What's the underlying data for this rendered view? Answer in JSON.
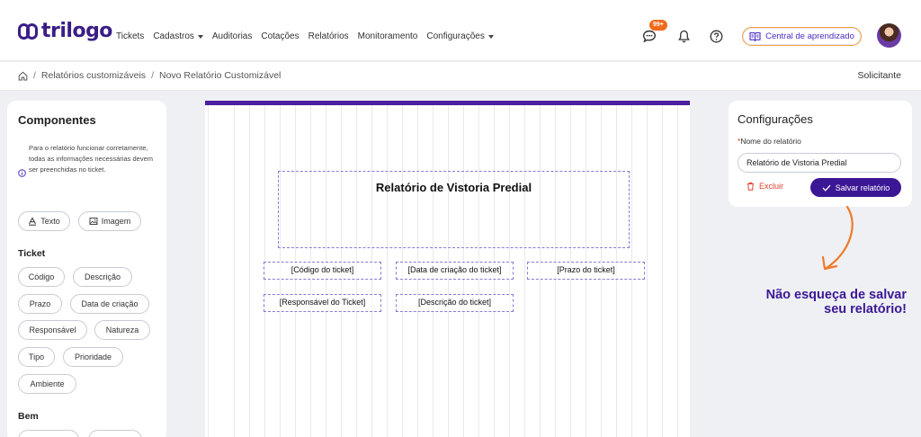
{
  "app": {
    "logo_text": "trilogo"
  },
  "nav": {
    "items": [
      {
        "label": "Tickets",
        "dropdown": false
      },
      {
        "label": "Cadastros",
        "dropdown": true
      },
      {
        "label": "Auditorias",
        "dropdown": false
      },
      {
        "label": "Cotações",
        "dropdown": false
      },
      {
        "label": "Relatórios",
        "dropdown": false
      },
      {
        "label": "Monitoramento",
        "dropdown": false
      },
      {
        "label": "Configurações",
        "dropdown": true
      }
    ]
  },
  "header": {
    "chat_badge": "99+",
    "learning_button": "Central de aprendizado",
    "icons": [
      "chat-icon",
      "bell-icon",
      "help-icon",
      "book-icon"
    ]
  },
  "breadcrumb": {
    "home_icon": "home-icon",
    "items": [
      "Relatórios customizáveis",
      "Novo Relatório Customizável"
    ],
    "role": "Solicitante"
  },
  "components_panel": {
    "title": "Componentes",
    "note": "Para o relatório funcionar corretamente, todas as informações necessárias devem ser preenchidas no ticket.",
    "basic": [
      {
        "label": "Texto",
        "icon": "text-icon"
      },
      {
        "label": "Imagem",
        "icon": "image-icon"
      }
    ],
    "ticket_section": "Ticket",
    "ticket_chips": [
      "Código",
      "Descrição",
      "Prazo",
      "Data de criação",
      "Responsável",
      "Natureza",
      "Tipo",
      "Prioridade",
      "Ambiente"
    ],
    "bem_section": "Bem"
  },
  "report": {
    "title": "Relatório de Vistoria Predial",
    "fields": [
      "[Código do ticket]",
      "[Data de criação do ticket]",
      "[Prazo do ticket]",
      "[Responsável do Ticket]",
      "[Descrição do ticket]"
    ]
  },
  "config_panel": {
    "title": "Configurações",
    "name_label": "Nome do relatório",
    "name_value": "Relatório de Vistoria Predial",
    "delete_label": "Excluir",
    "save_label": "Salvar relatório"
  },
  "hint": {
    "line1": "Não esqueça de salvar",
    "line2": "seu relatório!"
  },
  "colors": {
    "brand": "#3b1796",
    "accent": "#f06a1d",
    "danger": "#e0412b"
  }
}
